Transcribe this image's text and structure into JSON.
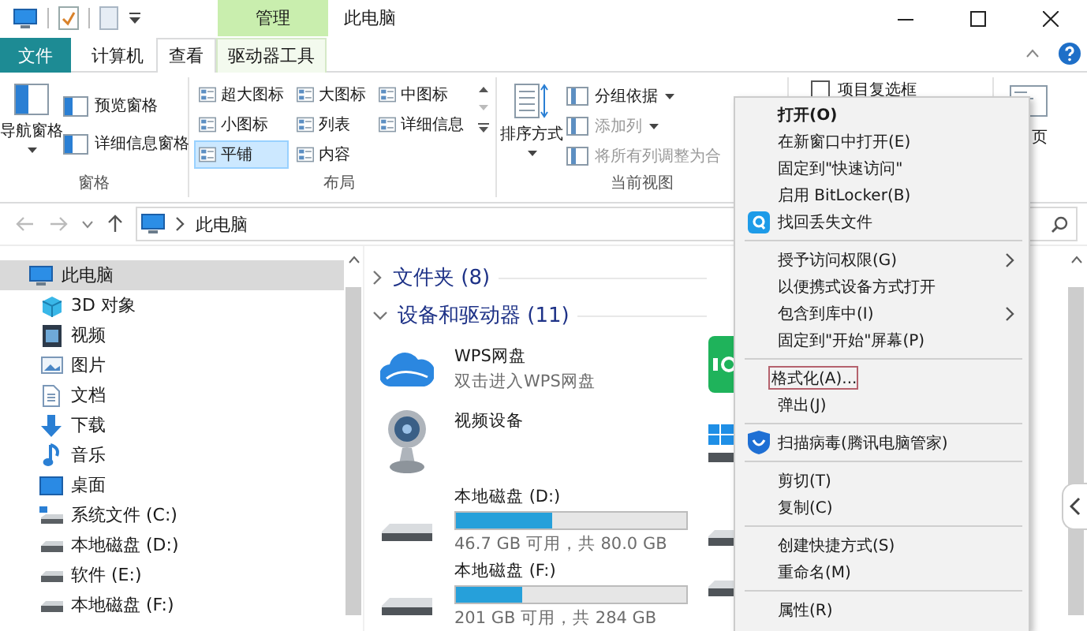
{
  "title_bar": {
    "contextual_tab": "管理",
    "title": "此电脑"
  },
  "ribbon_tabs": [
    {
      "label": "文件",
      "kind": "file",
      "selected": false
    },
    {
      "label": "计算机",
      "kind": "normal",
      "selected": false
    },
    {
      "label": "查看",
      "kind": "normal",
      "selected": true
    },
    {
      "label": "驱动器工具",
      "kind": "contextual",
      "selected": false
    }
  ],
  "ribbon": {
    "panes": {
      "title": "窗格",
      "big_button": "导航窗格",
      "buttons": [
        "预览窗格",
        "详细信息窗格"
      ]
    },
    "layout": {
      "title": "布局",
      "options": [
        {
          "label": "超大图标",
          "selected": false
        },
        {
          "label": "大图标",
          "selected": false
        },
        {
          "label": "中图标",
          "selected": false
        },
        {
          "label": "小图标",
          "selected": false
        },
        {
          "label": "列表",
          "selected": false
        },
        {
          "label": "详细信息",
          "selected": false
        },
        {
          "label": "平铺",
          "selected": true
        },
        {
          "label": "内容",
          "selected": false
        }
      ]
    },
    "current_view": {
      "title": "当前视图",
      "big_button": "排序方式",
      "buttons": [
        {
          "label": "分组依据",
          "disabled": false
        },
        {
          "label": "添加列",
          "disabled": true
        },
        {
          "label": "将所有列调整为合",
          "disabled": true
        }
      ]
    },
    "show_hide": {
      "checkbox": {
        "label": "项目复选框",
        "checked": false
      }
    },
    "options": {
      "label": "页"
    }
  },
  "address_bar": {
    "path": "此电脑"
  },
  "navigation": {
    "items": [
      {
        "label": "此电脑",
        "selected": true,
        "children": [
          {
            "label": "3D 对象",
            "kind": "objects3d",
            "selected": false
          },
          {
            "label": "视频",
            "kind": "videos",
            "selected": false
          },
          {
            "label": "图片",
            "kind": "pictures",
            "selected": false
          },
          {
            "label": "文档",
            "kind": "documents",
            "selected": false
          },
          {
            "label": "下载",
            "kind": "downloads",
            "selected": false
          },
          {
            "label": "音乐",
            "kind": "music",
            "selected": false
          },
          {
            "label": "桌面",
            "kind": "desktop",
            "selected": false
          },
          {
            "label": "系统文件 (C:)",
            "kind": "system_drive",
            "selected": false
          },
          {
            "label": "本地磁盘 (D:)",
            "kind": "drive",
            "selected": false
          },
          {
            "label": "软件 (E:)",
            "kind": "drive",
            "selected": false
          },
          {
            "label": "本地磁盘 (F:)",
            "kind": "drive",
            "selected": false
          }
        ]
      }
    ]
  },
  "content": {
    "groups": [
      {
        "label": "文件夹 (8)",
        "expanded": false
      },
      {
        "label": "设备和驱动器 (11)",
        "expanded": true,
        "items": [
          {
            "kind": "cloud",
            "name": "WPS网盘",
            "subtitle": "双击进入WPS网盘"
          },
          {
            "kind": "camera",
            "name": "视频设备"
          },
          {
            "kind": "drive",
            "name": "本地磁盘 (D:)",
            "level": 0.42,
            "reading": "46.7 GB 可用，共 80.0 GB"
          },
          {
            "kind": "drive",
            "name": "本地磁盘 (F:)",
            "level": 0.29,
            "reading": "201 GB 可用，共 284 GB"
          }
        ]
      }
    ]
  },
  "context_menu": {
    "items": [
      {
        "kind": "plain",
        "label": "打开(O)",
        "default": true,
        "submenu": false,
        "focused": false
      },
      {
        "kind": "plain",
        "label": "在新窗口中打开(E)",
        "default": false,
        "submenu": false,
        "focused": false
      },
      {
        "kind": "plain",
        "label": "固定到\"快速访问\"",
        "default": false,
        "submenu": false,
        "focused": false
      },
      {
        "kind": "plain",
        "label": "启用 BitLocker(B)",
        "default": false,
        "submenu": false,
        "focused": false
      },
      {
        "kind": "recovery",
        "label": "找回丢失文件",
        "default": false,
        "submenu": false,
        "focused": false
      },
      {
        "kind": "separator"
      },
      {
        "kind": "plain",
        "label": "授予访问权限(G)",
        "default": false,
        "submenu": true,
        "focused": false
      },
      {
        "kind": "plain",
        "label": "以便携式设备方式打开",
        "default": false,
        "submenu": false,
        "focused": false
      },
      {
        "kind": "plain",
        "label": "包含到库中(I)",
        "default": false,
        "submenu": true,
        "focused": false
      },
      {
        "kind": "plain",
        "label": "固定到\"开始\"屏幕(P)",
        "default": false,
        "submenu": false,
        "focused": false
      },
      {
        "kind": "separator"
      },
      {
        "kind": "plain",
        "label": "格式化(A)...",
        "default": false,
        "submenu": false,
        "focused": true
      },
      {
        "kind": "plain",
        "label": "弹出(J)",
        "default": false,
        "submenu": false,
        "focused": false
      },
      {
        "kind": "separator"
      },
      {
        "kind": "antivirus",
        "label": "扫描病毒(腾讯电脑管家)",
        "default": false,
        "submenu": false,
        "focused": false
      },
      {
        "kind": "separator"
      },
      {
        "kind": "plain",
        "label": "剪切(T)",
        "default": false,
        "submenu": false,
        "focused": false
      },
      {
        "kind": "plain",
        "label": "复制(C)",
        "default": false,
        "submenu": false,
        "focused": false
      },
      {
        "kind": "separator"
      },
      {
        "kind": "plain",
        "label": "创建快捷方式(S)",
        "default": false,
        "submenu": false,
        "focused": false
      },
      {
        "kind": "plain",
        "label": "重命名(M)",
        "default": false,
        "submenu": false,
        "focused": false
      },
      {
        "kind": "separator"
      },
      {
        "kind": "plain",
        "label": "属性(R)",
        "default": false,
        "submenu": false,
        "focused": false
      }
    ]
  }
}
